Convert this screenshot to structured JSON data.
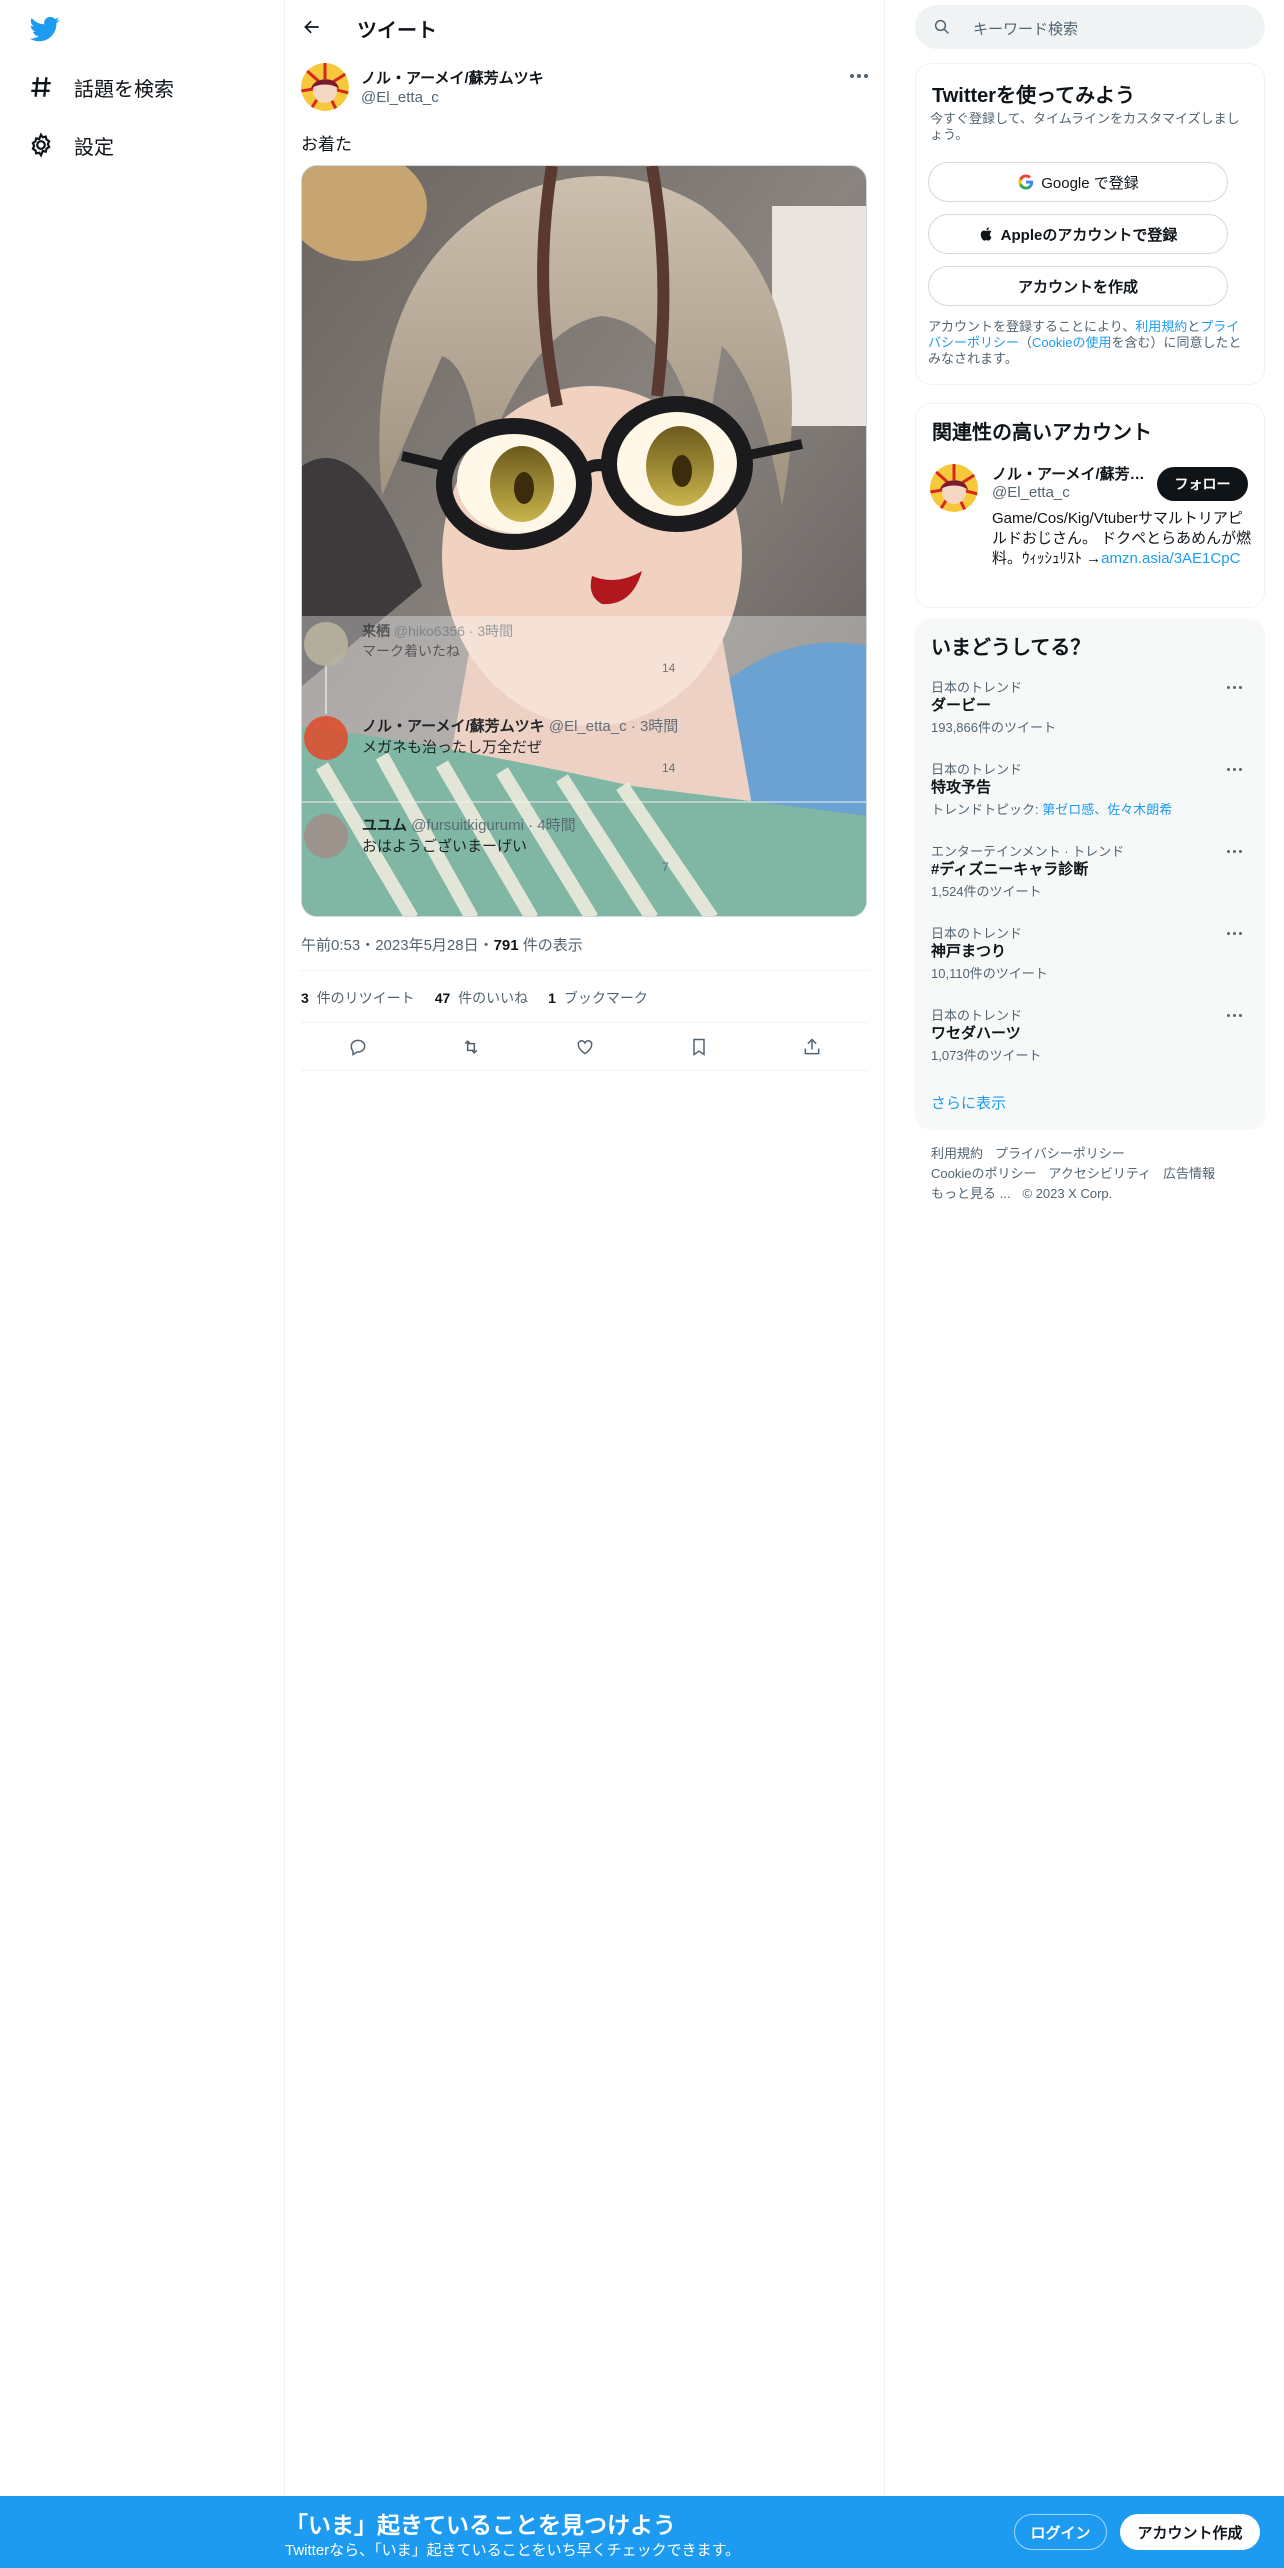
{
  "nav": {
    "logo": "twitter-bird-icon",
    "items": [
      {
        "label": "話題を検索",
        "icon": "hashtag-icon"
      },
      {
        "label": "設定",
        "icon": "gear-icon"
      }
    ]
  },
  "header": {
    "title": "ツイート",
    "back_icon": "arrow-left-icon"
  },
  "tweet": {
    "author_name": "ノル・アーメイ/蘇芳ムツキ",
    "author_handle": "@El_etta_c",
    "text": "お着た",
    "media_overlay": {
      "replies": [
        {
          "name": "来栖",
          "handle": "@hiko6356 · 3時間",
          "text": "マーク着いたね",
          "views": "14"
        },
        {
          "name": "ノル・アーメイ/蘇芳ムツキ",
          "handle": "@El_etta_c · 3時間",
          "text": "メガネも治ったし万全だぜ",
          "views": "14"
        },
        {
          "name": "ユユム",
          "handle": "@fursuitkigurumi · 4時間",
          "text": "おはようございまーげい",
          "views": "7"
        }
      ]
    },
    "time": "午前0:53・2023年5月28日・",
    "views_count": "791",
    "views_label": " 件の表示",
    "retweets_count": "3",
    "retweets_label": " 件のリツイート",
    "likes_count": "47",
    "likes_label": " 件のいいね",
    "bookmarks_count": "1",
    "bookmarks_label": " ブックマーク"
  },
  "search": {
    "placeholder": "キーワード検索"
  },
  "signup_card": {
    "title": "Twitterを使ってみよう",
    "description": "今すぐ登録して、タイムラインをカスタマイズしましょう。",
    "google_label": "Google で登録",
    "apple_label": "Appleのアカウントで登録",
    "create_label": "アカウントを作成",
    "legal_prefix": "アカウントを登録することにより、",
    "legal_terms": "利用規約",
    "legal_and": "と",
    "legal_privacy": "プライバシーポリシー",
    "legal_cookie_open": "（",
    "legal_cookie": "Cookieの使用",
    "legal_suffix": "を含む）に同意したとみなされます。"
  },
  "related": {
    "title": "関連性の高いアカウント",
    "name": "ノル・アーメイ/蘇芳ムツキ",
    "handle": "@El_etta_c",
    "follow_label": "フォロー",
    "bio": "Game/Cos/Kig/Vtuberサマルトリアピルドおじさん。 ドクペとらあめんが燃料。ｳｨｯｼｭﾘｽﾄ →",
    "bio_link": "amzn.asia/3AE1CpC"
  },
  "trends": {
    "title": "いまどうしてる？",
    "items": [
      {
        "context": "日本のトレンド",
        "name": "ダービー",
        "count": "193,866件のツイート",
        "topic_prefix": "",
        "topic": ""
      },
      {
        "context": "日本のトレンド",
        "name": "特攻予告",
        "count": "",
        "topic_prefix": "トレンドトピック: ",
        "topic": "第ゼロ感、佐々木朗希"
      },
      {
        "context": "エンターテインメント · トレンド",
        "name": "#ディズニーキャラ診断",
        "count": "1,524件のツイート",
        "topic_prefix": "",
        "topic": ""
      },
      {
        "context": "日本のトレンド",
        "name": "神戸まつり",
        "count": "10,110件のツイート",
        "topic_prefix": "",
        "topic": ""
      },
      {
        "context": "日本のトレンド",
        "name": "ワセダハーツ",
        "count": "1,073件のツイート",
        "topic_prefix": "",
        "topic": ""
      }
    ],
    "show_more": "さらに表示"
  },
  "footer": {
    "terms": "利用規約",
    "privacy": "プライバシーポリシー",
    "cookie": "Cookieのポリシー",
    "accessibility": "アクセシビリティ",
    "ads": "広告情報",
    "more": "もっと見る ...",
    "copyright": "© 2023 X Corp."
  },
  "banner": {
    "title": "「いま」起きていることを見つけよう",
    "subtitle": "Twitterなら、「いま」起きていることをいち早くチェックできます。",
    "login": "ログイン",
    "signup": "アカウント作成"
  },
  "colors": {
    "accent": "#1d9bf0",
    "text": "#0f1419",
    "secondary": "#536471"
  }
}
